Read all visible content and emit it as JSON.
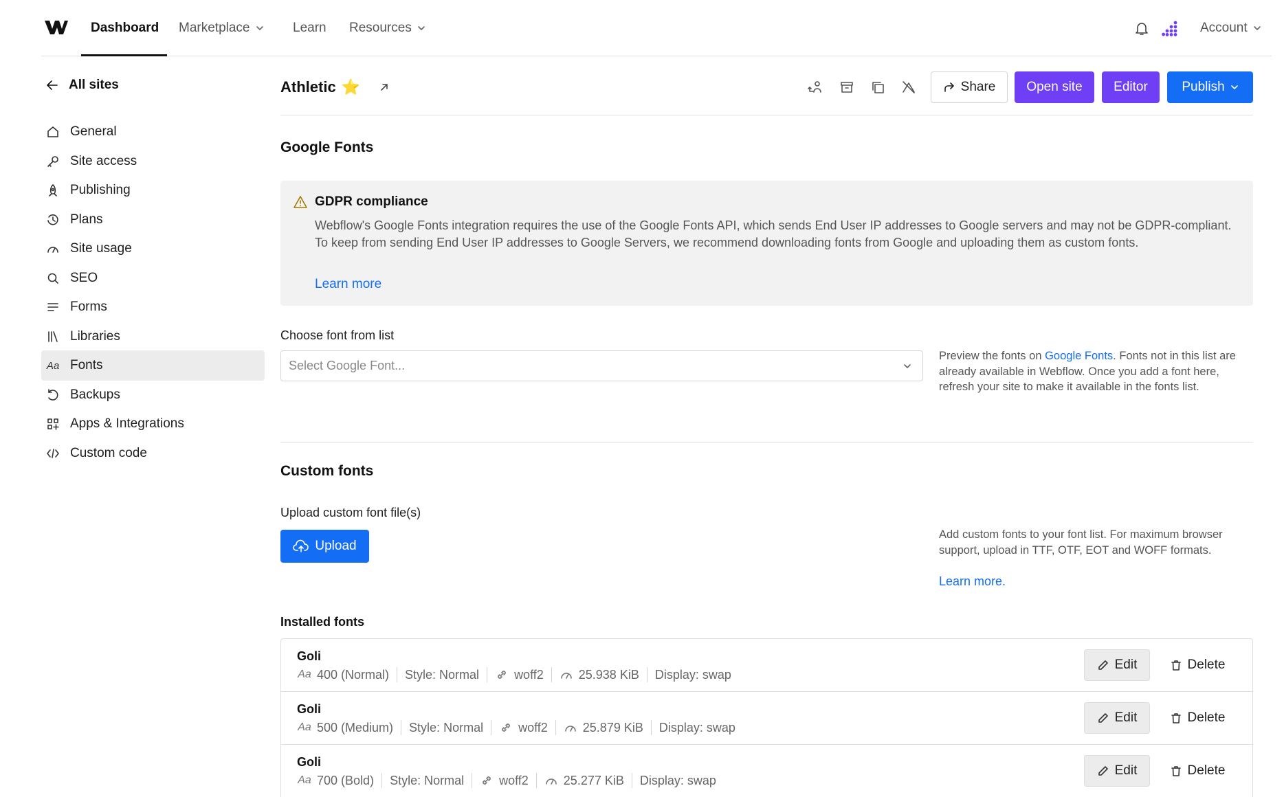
{
  "nav": {
    "items": [
      {
        "label": "Dashboard"
      },
      {
        "label": "Marketplace"
      },
      {
        "label": "Learn"
      },
      {
        "label": "Resources"
      }
    ],
    "account_label": "Account"
  },
  "sidebar": {
    "back_label": "All sites",
    "items": [
      {
        "label": "General",
        "icon": "home-icon"
      },
      {
        "label": "Site access",
        "icon": "key-icon"
      },
      {
        "label": "Publishing",
        "icon": "rocket-icon"
      },
      {
        "label": "Plans",
        "icon": "plans-icon"
      },
      {
        "label": "Site usage",
        "icon": "gauge-icon"
      },
      {
        "label": "SEO",
        "icon": "search-icon"
      },
      {
        "label": "Forms",
        "icon": "forms-icon"
      },
      {
        "label": "Libraries",
        "icon": "libraries-icon"
      },
      {
        "label": "Fonts",
        "icon": "fonts-icon",
        "glyph": "Aa",
        "active": true
      },
      {
        "label": "Backups",
        "icon": "backup-icon"
      },
      {
        "label": "Apps & Integrations",
        "icon": "apps-icon"
      },
      {
        "label": "Custom code",
        "icon": "code-icon"
      }
    ]
  },
  "header": {
    "site_name": "Athletic",
    "star": "⭐",
    "share_label": "Share",
    "open_site_label": "Open site",
    "editor_label": "Editor",
    "publish_label": "Publish"
  },
  "google_fonts": {
    "title": "Google Fonts",
    "notice": {
      "title": "GDPR compliance",
      "text": "Webflow's Google Fonts integration requires the use of the Google Fonts API, which sends End User IP addresses to Google servers and may not be GDPR-compliant. To keep from sending End User IP addresses to Google Servers, we recommend downloading fonts from Google and uploading them as custom fonts.",
      "link": "Learn more"
    },
    "choose_label": "Choose font from list",
    "select_placeholder": "Select Google Font...",
    "help_prefix": "Preview the fonts on ",
    "help_link": "Google Fonts",
    "help_suffix": ". Fonts not in this list are already available in Webflow. Once you add a font here, refresh your site to make it available in the fonts list."
  },
  "custom_fonts": {
    "title": "Custom fonts",
    "upload_label": "Upload custom font file(s)",
    "upload_button": "Upload",
    "help": "Add custom fonts to your font list. For maximum browser support, upload in TTF, OTF, EOT and WOFF formats.",
    "learn_more": "Learn more."
  },
  "installed": {
    "title": "Installed fonts",
    "edit_label": "Edit",
    "delete_label": "Delete",
    "fonts": [
      {
        "name": "Goli",
        "weight": "400 (Normal)",
        "style": "Style: Normal",
        "format": "woff2",
        "size": "25.938 KiB",
        "display": "Display: swap"
      },
      {
        "name": "Goli",
        "weight": "500 (Medium)",
        "style": "Style: Normal",
        "format": "woff2",
        "size": "25.879 KiB",
        "display": "Display: swap"
      },
      {
        "name": "Goli",
        "weight": "700 (Bold)",
        "style": "Style: Normal",
        "format": "woff2",
        "size": "25.277 KiB",
        "display": "Display: swap"
      }
    ]
  },
  "colors": {
    "accent_purple": "#6f3ff5",
    "accent_blue": "#146ef5",
    "active_sidebar_bg": "#ececec"
  }
}
